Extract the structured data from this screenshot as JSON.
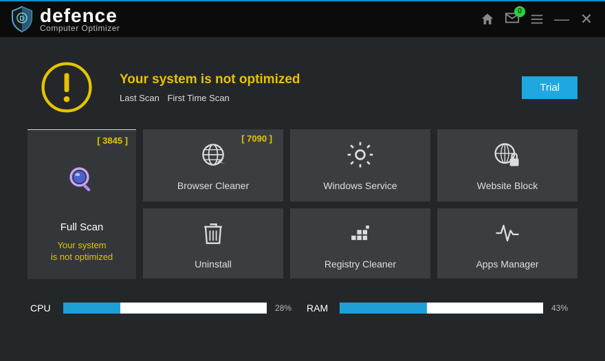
{
  "brand": {
    "name": "defence",
    "sub": "Computer Optimizer"
  },
  "header": {
    "mail_badge": "0"
  },
  "alert": {
    "title": "Your system is not optimized",
    "last_scan_label": "Last Scan",
    "last_scan_value": "First Time Scan",
    "trial_button": "Trial"
  },
  "tiles": {
    "full_scan": {
      "badge": "[ 3845 ]",
      "label": "Full Scan",
      "status": "Your system\nis not optimized"
    },
    "browser_cleaner": {
      "badge": "[ 7090 ]",
      "label": "Browser Cleaner"
    },
    "windows_service": {
      "label": "Windows Service"
    },
    "website_block": {
      "label": "Website Block"
    },
    "uninstall": {
      "label": "Uninstall"
    },
    "registry_cleaner": {
      "label": "Registry Cleaner"
    },
    "apps_manager": {
      "label": "Apps Manager"
    }
  },
  "meters": {
    "cpu": {
      "label": "CPU",
      "pct": 28,
      "pct_text": "28%"
    },
    "ram": {
      "label": "RAM",
      "pct": 43,
      "pct_text": "43%"
    }
  }
}
